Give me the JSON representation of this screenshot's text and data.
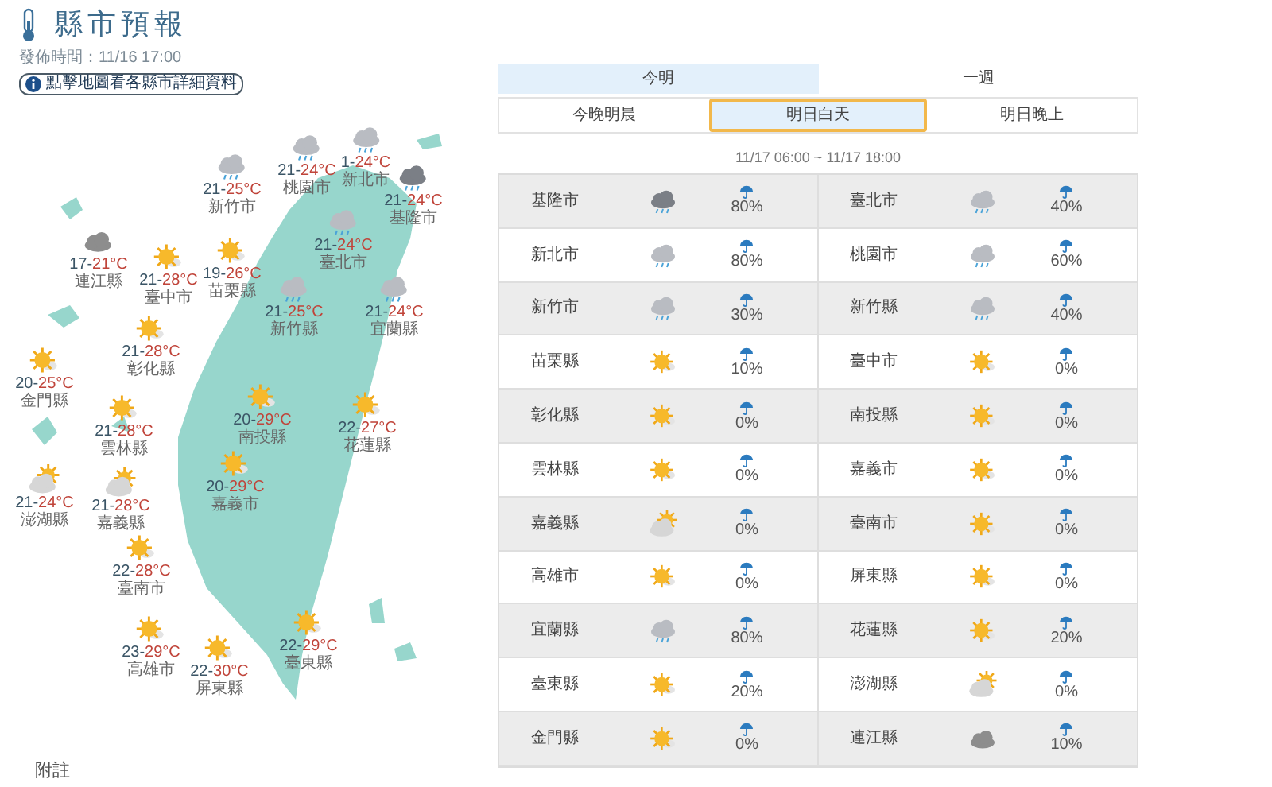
{
  "header": {
    "title": "縣市預報",
    "published": "發佈時間：11/16 17:00",
    "map_hint": "點擊地圖看各縣市詳細資料"
  },
  "map": [
    {
      "name": "新竹市",
      "kind": "rain",
      "low": "21-",
      "high": "25°C"
    },
    {
      "name": "桃園市",
      "kind": "rain",
      "low": "21-",
      "high": "24°C"
    },
    {
      "name": "新北市",
      "kind": "rain",
      "low": "1-",
      "high": "24°C"
    },
    {
      "name": "基隆市",
      "kind": "heavy-rain",
      "low": "21-",
      "high": "24°C"
    },
    {
      "name": "臺北市",
      "kind": "rain",
      "low": "21-",
      "high": "24°C"
    },
    {
      "name": "連江縣",
      "kind": "cloudy",
      "low": "17-",
      "high": "21°C"
    },
    {
      "name": "臺中市",
      "kind": "sunny",
      "low": "21-",
      "high": "28°C"
    },
    {
      "name": "苗栗縣",
      "kind": "sunny",
      "low": "19-",
      "high": "26°C"
    },
    {
      "name": "新竹縣",
      "kind": "rain",
      "low": "21-",
      "high": "25°C"
    },
    {
      "name": "宜蘭縣",
      "kind": "rain",
      "low": "21-",
      "high": "24°C"
    },
    {
      "name": "彰化縣",
      "kind": "sunny",
      "low": "21-",
      "high": "28°C"
    },
    {
      "name": "金門縣",
      "kind": "sunny",
      "low": "20-",
      "high": "25°C"
    },
    {
      "name": "雲林縣",
      "kind": "sunny",
      "low": "21-",
      "high": "28°C"
    },
    {
      "name": "南投縣",
      "kind": "sunny",
      "low": "20-",
      "high": "29°C"
    },
    {
      "name": "花蓮縣",
      "kind": "sunny",
      "low": "22-",
      "high": "27°C"
    },
    {
      "name": "嘉義市",
      "kind": "sunny",
      "low": "20-",
      "high": "29°C"
    },
    {
      "name": "澎湖縣",
      "kind": "partly-cloudy",
      "low": "21-",
      "high": "24°C"
    },
    {
      "name": "嘉義縣",
      "kind": "partly-cloudy",
      "low": "21-",
      "high": "28°C"
    },
    {
      "name": "臺南市",
      "kind": "sunny",
      "low": "22-",
      "high": "28°C"
    },
    {
      "name": "高雄市",
      "kind": "sunny",
      "low": "23-",
      "high": "29°C"
    },
    {
      "name": "屏東縣",
      "kind": "sunny",
      "low": "22-",
      "high": "30°C"
    },
    {
      "name": "臺東縣",
      "kind": "sunny",
      "low": "22-",
      "high": "29°C"
    }
  ],
  "footnote": "附註",
  "tabs": [
    {
      "label": "今明",
      "selected": true
    },
    {
      "label": "一週",
      "selected": false
    }
  ],
  "sub_tabs": [
    {
      "label": "今晚明晨",
      "selected": false
    },
    {
      "label": "明日白天",
      "selected": true
    },
    {
      "label": "明日晚上",
      "selected": false
    }
  ],
  "period": "11/17 06:00 ~ 11/17 18:00",
  "forecast": [
    {
      "name": "基隆市",
      "kind": "heavy-rain",
      "rain": "80%"
    },
    {
      "name": "臺北市",
      "kind": "rain",
      "rain": "40%"
    },
    {
      "name": "新北市",
      "kind": "rain",
      "rain": "80%"
    },
    {
      "name": "桃園市",
      "kind": "rain",
      "rain": "60%"
    },
    {
      "name": "新竹市",
      "kind": "rain",
      "rain": "30%"
    },
    {
      "name": "新竹縣",
      "kind": "rain",
      "rain": "40%"
    },
    {
      "name": "苗栗縣",
      "kind": "sunny",
      "rain": "10%"
    },
    {
      "name": "臺中市",
      "kind": "sunny",
      "rain": "0%"
    },
    {
      "name": "彰化縣",
      "kind": "sunny",
      "rain": "0%"
    },
    {
      "name": "南投縣",
      "kind": "sunny",
      "rain": "0%"
    },
    {
      "name": "雲林縣",
      "kind": "sunny",
      "rain": "0%"
    },
    {
      "name": "嘉義市",
      "kind": "sunny",
      "rain": "0%"
    },
    {
      "name": "嘉義縣",
      "kind": "partly-cloudy",
      "rain": "0%"
    },
    {
      "name": "臺南市",
      "kind": "sunny",
      "rain": "0%"
    },
    {
      "name": "高雄市",
      "kind": "sunny",
      "rain": "0%"
    },
    {
      "name": "屏東縣",
      "kind": "sunny",
      "rain": "0%"
    },
    {
      "name": "宜蘭縣",
      "kind": "rain",
      "rain": "80%"
    },
    {
      "name": "花蓮縣",
      "kind": "sunny",
      "rain": "20%"
    },
    {
      "name": "臺東縣",
      "kind": "sunny",
      "rain": "20%"
    },
    {
      "name": "澎湖縣",
      "kind": "partly-cloudy",
      "rain": "0%"
    },
    {
      "name": "金門縣",
      "kind": "sunny",
      "rain": "0%"
    },
    {
      "name": "連江縣",
      "kind": "cloudy",
      "rain": "10%"
    }
  ]
}
